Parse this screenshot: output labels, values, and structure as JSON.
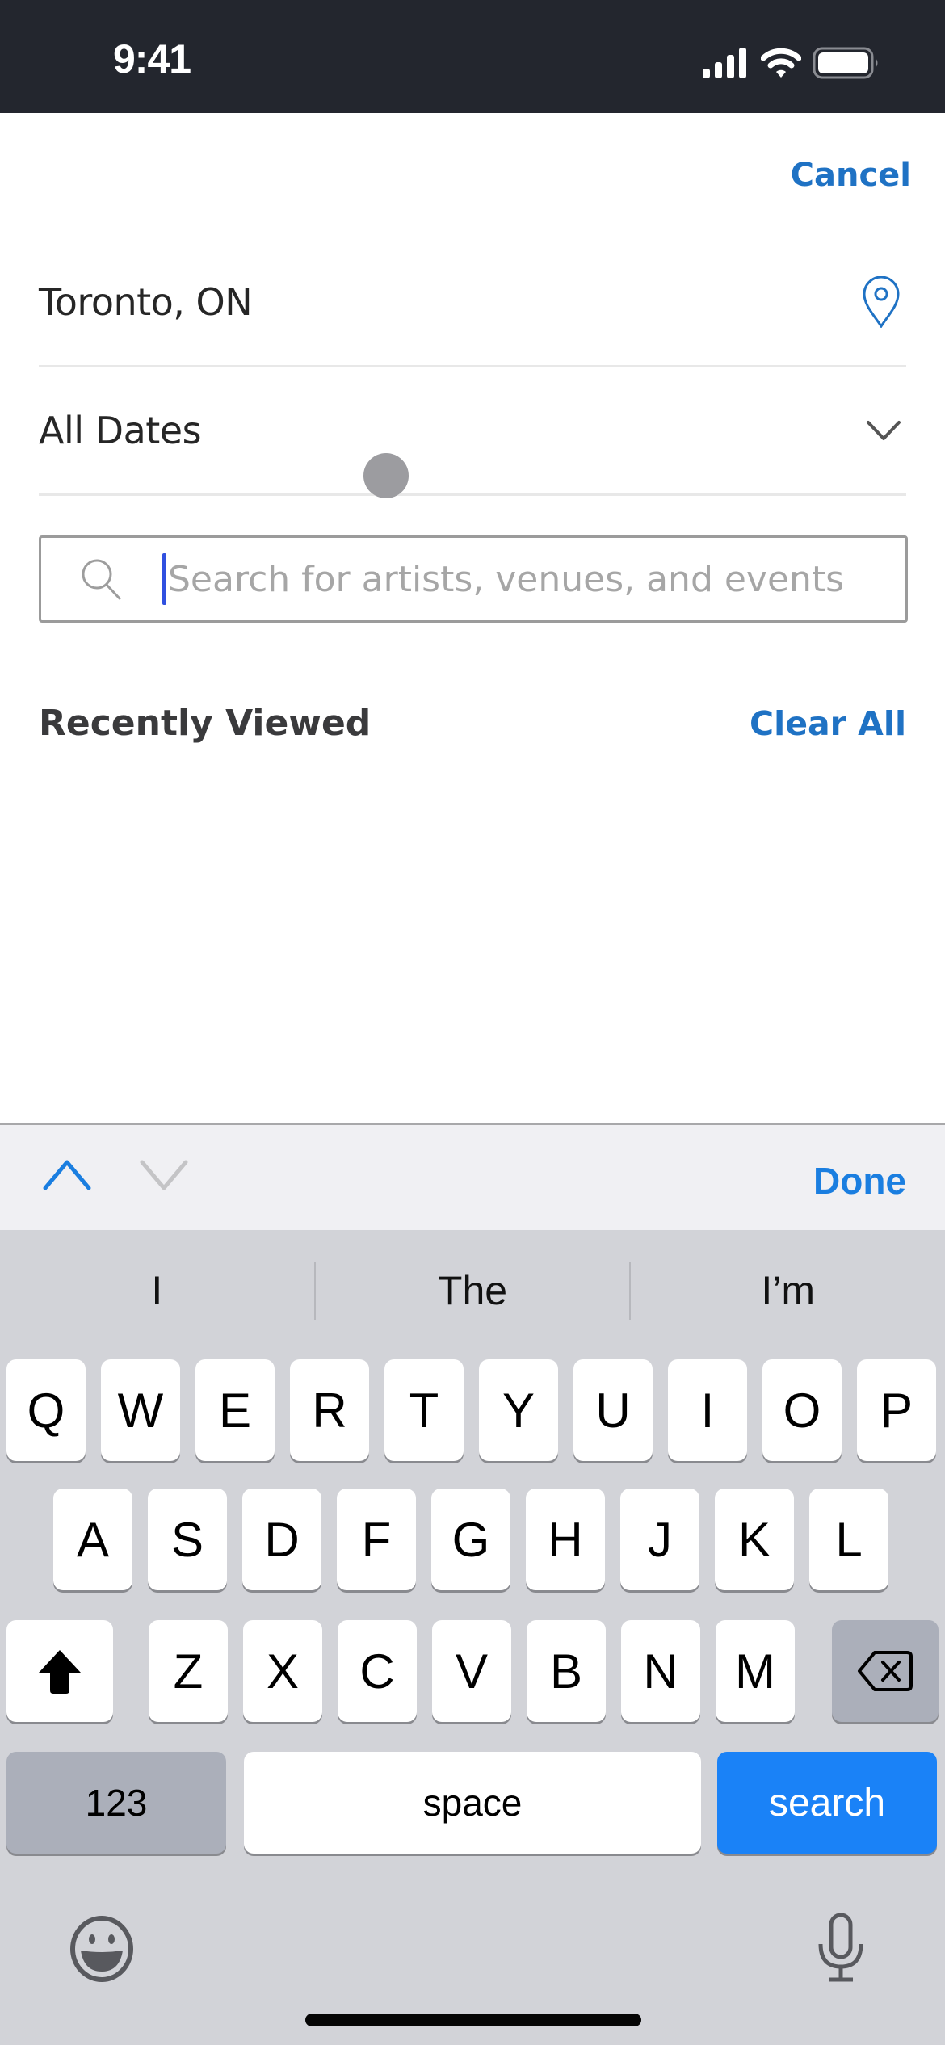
{
  "status_bar": {
    "time": "9:41",
    "icons": [
      "cellular-signal-icon",
      "wifi-icon",
      "battery-icon"
    ]
  },
  "header": {
    "cancel_label": "Cancel"
  },
  "filters": {
    "location": {
      "value": "Toronto, ON",
      "icon": "location-pin-icon"
    },
    "dates": {
      "value": "All Dates",
      "icon": "chevron-down-icon"
    }
  },
  "search": {
    "value": "",
    "placeholder": "Search for artists, venues, and events",
    "icon": "search-icon"
  },
  "recently_viewed": {
    "title": "Recently Viewed",
    "clear_label": "Clear All",
    "items": []
  },
  "keyboard_accessory": {
    "prev_icon": "chevron-up-icon",
    "next_icon": "chevron-down-icon",
    "done_label": "Done"
  },
  "keyboard": {
    "predictions": [
      "I",
      "The",
      "I’m"
    ],
    "row1": [
      "Q",
      "W",
      "E",
      "R",
      "T",
      "Y",
      "U",
      "I",
      "O",
      "P"
    ],
    "row2": [
      "A",
      "S",
      "D",
      "F",
      "G",
      "H",
      "J",
      "K",
      "L"
    ],
    "row3": [
      "Z",
      "X",
      "C",
      "V",
      "B",
      "N",
      "M"
    ],
    "numbers_label": "123",
    "space_label": "space",
    "return_label": "search",
    "shift_icon": "shift-icon",
    "delete_icon": "backspace-icon",
    "emoji_icon": "emoji-icon",
    "dictation_icon": "microphone-icon"
  },
  "colors": {
    "accent": "#1f72c4",
    "keyboard_return": "#1a82f7",
    "status_bar_bg": "#23262e",
    "keyboard_bg": "#d2d3d8"
  }
}
